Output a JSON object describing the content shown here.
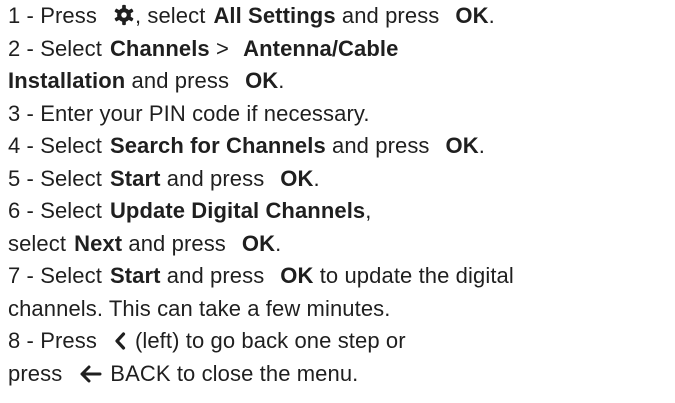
{
  "steps": {
    "s1": {
      "num": "1 - ",
      "a": "Press",
      "b": ", select",
      "c": "All Settings",
      "d": "and press",
      "e": "OK",
      "f": "."
    },
    "s2": {
      "num": "2 - ",
      "a": "Select",
      "b": "Channels",
      "c": " > ",
      "d": "Antenna/Cable",
      "e": "Installation",
      "f": " and press",
      "g": "OK",
      "h": "."
    },
    "s3": {
      "num": "3 - ",
      "text": "Enter your PIN code if necessary."
    },
    "s4": {
      "num": "4 - ",
      "a": "Select",
      "b": "Search for Channels",
      "c": "and press",
      "d": "OK",
      "e": "."
    },
    "s5": {
      "num": "5 - ",
      "a": "Select",
      "b": "Start",
      "c": "and press",
      "d": "OK",
      "e": "."
    },
    "s6": {
      "num": "6 - ",
      "a": "Select",
      "b": "Update Digital Channels",
      "c": ",",
      "d": "select",
      "e": "Next",
      "f": "and press",
      "g": "OK",
      "h": "."
    },
    "s7": {
      "num": "7 - ",
      "a": "Select",
      "b": "Start",
      "c": "and press",
      "d": "OK",
      "e": " to update the digital",
      "f": "channels. This can take a few minutes."
    },
    "s8": {
      "num": "8 - ",
      "a": "Press",
      "b": "(left) to go back one step or",
      "c": "press",
      "d": "BACK to close the menu."
    }
  },
  "icons": [
    "settings-gear-icon",
    "chevron-left-icon",
    "back-arrow-icon"
  ]
}
